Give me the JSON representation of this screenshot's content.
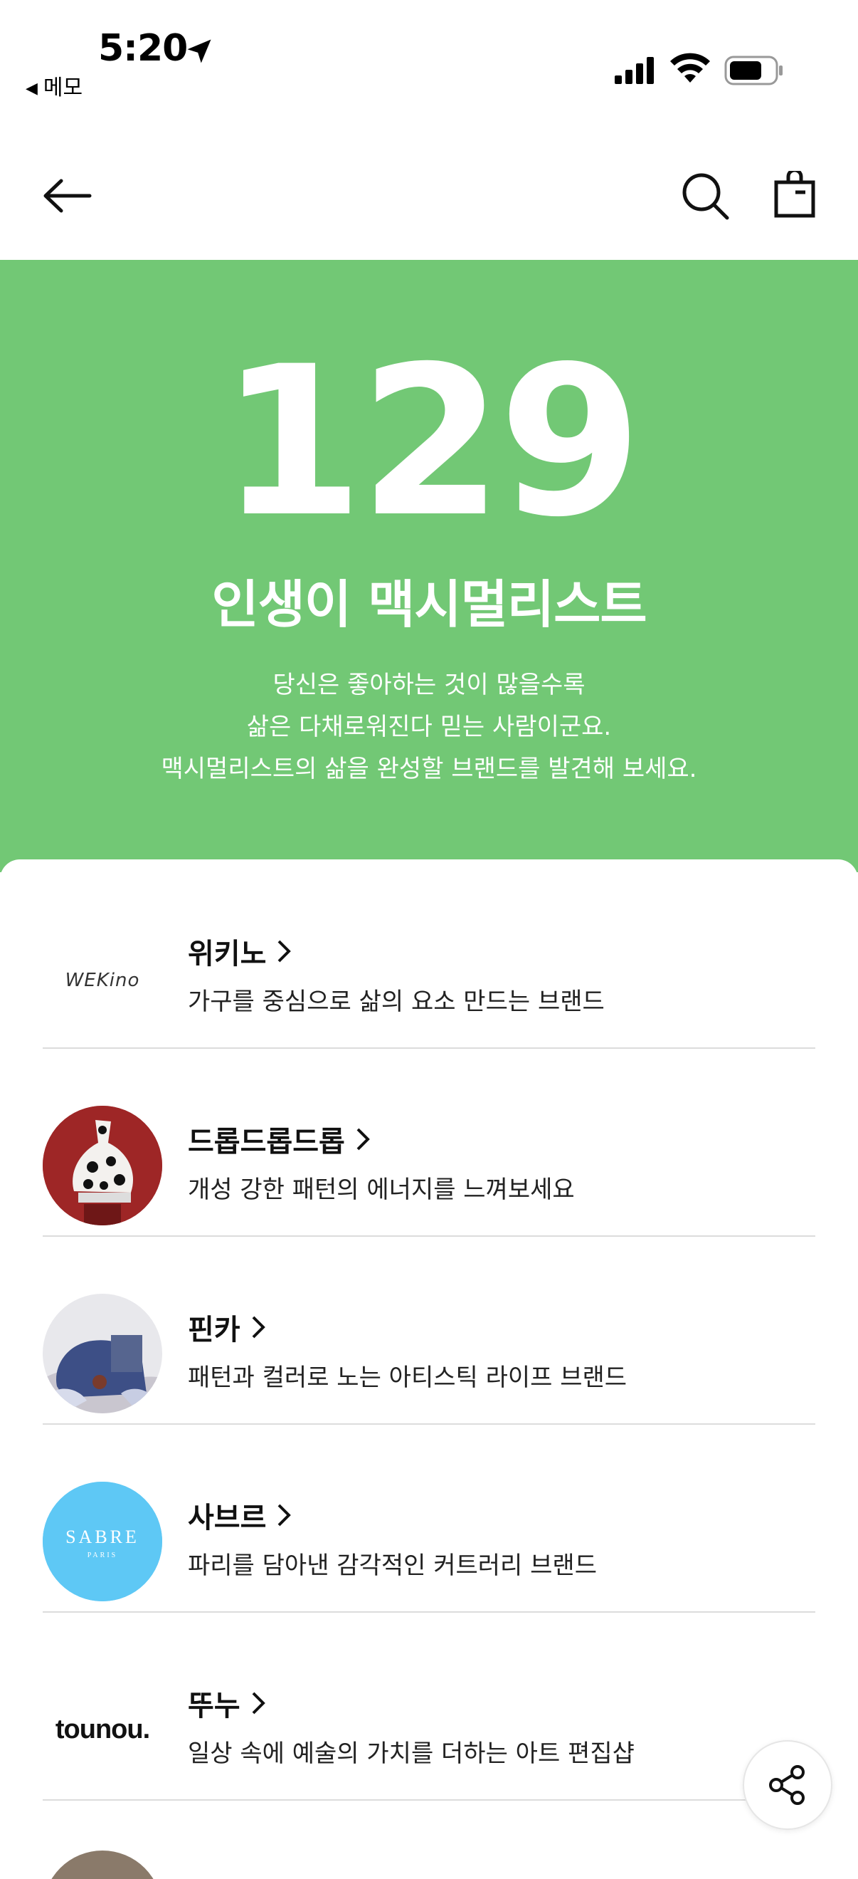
{
  "status_bar": {
    "time": "5:20",
    "back_app_label": "메모"
  },
  "nav": {
    "back_icon": "arrow-left-icon",
    "search_icon": "search-icon",
    "bag_icon": "shopping-bag-icon"
  },
  "hero": {
    "background_color": "#72c875",
    "number": "129",
    "title": "인생이 맥시멀리스트",
    "description_lines": [
      "당신은 좋아하는 것이 많을수록",
      "삶은 다채로워진다 믿는 사람이군요.",
      "맥시멀리스트의 삶을 완성할 브랜드를 발견해 보세요."
    ]
  },
  "brands": [
    {
      "name": "위키노",
      "description": "가구를 중심으로 삶의 요소 만드는 브랜드",
      "logo_text": "WEKino"
    },
    {
      "name": "드롭드롭드롭",
      "description": "개성 강한 패턴의 에너지를 느껴보세요",
      "logo_text": ""
    },
    {
      "name": "핀카",
      "description": "패턴과 컬러로 노는 아티스틱 라이프 브랜드",
      "logo_text": ""
    },
    {
      "name": "사브르",
      "description": "파리를 담아낸 감각적인 커트러리 브랜드",
      "logo_text": "SABRE",
      "logo_subtext": "PARIS"
    },
    {
      "name": "뚜누",
      "description": "일상 속에 예술의 가치를 더하는 아트 편집샵",
      "logo_text": "tounou."
    }
  ],
  "share_icon": "share-icon"
}
